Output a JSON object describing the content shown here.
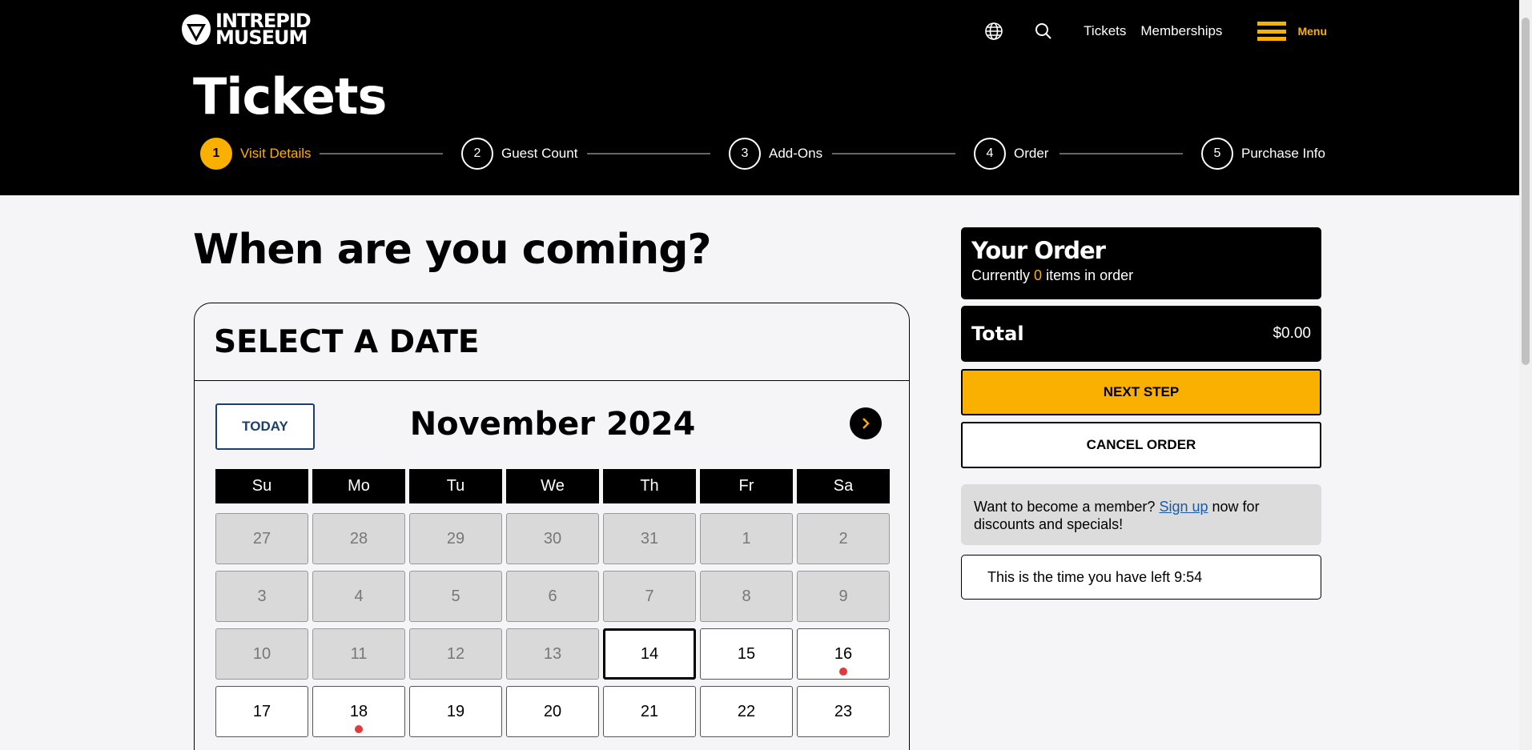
{
  "header": {
    "logo_text_1": "INTREPID",
    "logo_text_2": "MUSEUM",
    "nav": {
      "tickets": "Tickets",
      "memberships": "Memberships",
      "menu": "Menu"
    },
    "title": "Tickets"
  },
  "colors": {
    "accent": "#f9b000",
    "header_bg": "#000000",
    "link": "#1a5ba8",
    "event_dot": "#e03a3a"
  },
  "stepper": [
    {
      "number": "1",
      "label": "Visit Details",
      "active": true
    },
    {
      "number": "2",
      "label": "Guest Count",
      "active": false
    },
    {
      "number": "3",
      "label": "Add-Ons",
      "active": false
    },
    {
      "number": "4",
      "label": "Order",
      "active": false
    },
    {
      "number": "5",
      "label": "Purchase Info",
      "active": false
    }
  ],
  "main": {
    "question": "When are you coming?",
    "calendar": {
      "heading": "SELECT A DATE",
      "today_label": "TODAY",
      "month": "November 2024",
      "weekdays": [
        "Su",
        "Mo",
        "Tu",
        "We",
        "Th",
        "Fr",
        "Sa"
      ],
      "days": [
        {
          "label": "27",
          "disabled": true
        },
        {
          "label": "28",
          "disabled": true
        },
        {
          "label": "29",
          "disabled": true
        },
        {
          "label": "30",
          "disabled": true
        },
        {
          "label": "31",
          "disabled": true
        },
        {
          "label": "1",
          "disabled": true
        },
        {
          "label": "2",
          "disabled": true
        },
        {
          "label": "3",
          "disabled": true
        },
        {
          "label": "4",
          "disabled": true
        },
        {
          "label": "5",
          "disabled": true
        },
        {
          "label": "6",
          "disabled": true
        },
        {
          "label": "7",
          "disabled": true
        },
        {
          "label": "8",
          "disabled": true
        },
        {
          "label": "9",
          "disabled": true
        },
        {
          "label": "10",
          "disabled": true
        },
        {
          "label": "11",
          "disabled": true
        },
        {
          "label": "12",
          "disabled": true
        },
        {
          "label": "13",
          "disabled": true
        },
        {
          "label": "14",
          "selected": true
        },
        {
          "label": "15"
        },
        {
          "label": "16",
          "dot": true
        },
        {
          "label": "17"
        },
        {
          "label": "18",
          "dot": true
        },
        {
          "label": "19"
        },
        {
          "label": "20"
        },
        {
          "label": "21"
        },
        {
          "label": "22"
        },
        {
          "label": "23"
        }
      ]
    }
  },
  "sidebar": {
    "order_title": "Your Order",
    "order_prefix": "Currently",
    "order_count": "0",
    "order_suffix": "items in order",
    "total_label": "Total",
    "total_value": "$0.00",
    "next_step": "NEXT STEP",
    "cancel": "CANCEL ORDER",
    "member_prefix": "Want to become a member?",
    "member_link": "Sign up",
    "member_suffix": "now for discounts and specials!",
    "timer_text": "This is the time you have left 9:54"
  }
}
